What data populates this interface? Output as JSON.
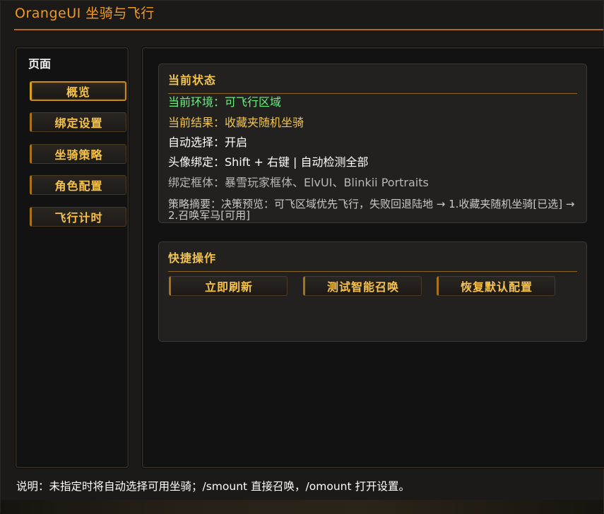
{
  "window": {
    "title": "OrangeUI 坐骑与飞行"
  },
  "sidebar": {
    "title": "页面",
    "items": [
      {
        "label": "概览",
        "active": true
      },
      {
        "label": "绑定设置",
        "active": false
      },
      {
        "label": "坐骑策略",
        "active": false
      },
      {
        "label": "角色配置",
        "active": false
      },
      {
        "label": "飞行计时",
        "active": false
      }
    ]
  },
  "status": {
    "title": "当前状态",
    "environment": "当前环境：可飞行区域",
    "result": "当前结果：收藏夹随机坐骑",
    "auto_select": "自动选择：开启",
    "portrait_bind": "头像绑定：Shift + 右键 | 自动检测全部",
    "bind_frames": "绑定框体：暴雪玩家框体、ElvUI、Blinkii Portraits",
    "summary": "策略摘要：决策预览：可飞区域优先飞行，失败回退陆地 → 1.收藏夹随机坐骑[已选] → 2.召唤军马[可用]"
  },
  "actions": {
    "title": "快捷操作",
    "refresh_label": "立即刷新",
    "test_label": "测试智能召唤",
    "reset_label": "恢复默认配置"
  },
  "footer": {
    "note": "说明：未指定时将自动选择可用坐骑；/smount 直接召唤，/omount 打开设置。"
  },
  "colors": {
    "accent": "#f29a1d",
    "gold_text": "#f1c44d",
    "green_text": "#6bf07e",
    "border_gold": "#a8721b"
  }
}
